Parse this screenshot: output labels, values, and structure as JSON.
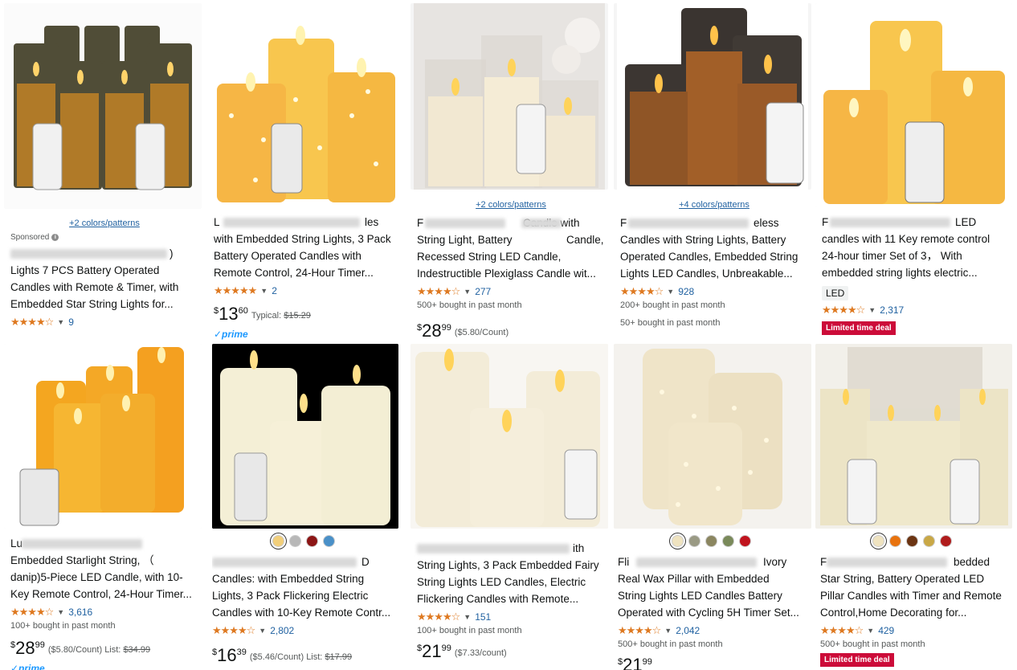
{
  "products": [
    {
      "colors_link": "+2 colors/patterns",
      "sponsored": "Sponsored",
      "title_lines": [
        "",
        "Lights 7 PCS Battery Operated",
        "Candles with Remote & Timer, with",
        "Embedded Star String Lights for..."
      ],
      "title_visible_end": ")",
      "stars": "★★★★☆",
      "rating_count": "9"
    },
    {
      "title_lines": [
        "L",
        "with Embedded String Lights, 3 Pack",
        "Battery Operated Candles with",
        "Remote Control, 24-Hour Timer..."
      ],
      "title_visible_end": "les",
      "stars": "★★★★★",
      "rating_count": "2",
      "price": {
        "currency": "$",
        "whole": "13",
        "fraction": "60",
        "typical_label": "Typical:",
        "typical": "$15.29"
      },
      "prime": "✓prime"
    },
    {
      "colors_link": "+2 colors/patterns",
      "title_lines": [
        "F",
        "String Light, Battery",
        "Recessed String LED Candle,",
        "Indestructible Plexiglass Candle wit..."
      ],
      "title_visible_end": "Candle with",
      "title_visible_end2": "Candle,",
      "stars": "★★★★☆",
      "rating_count": "277",
      "bought": "500+ bought in past month",
      "price": {
        "currency": "$",
        "whole": "28",
        "fraction": "99",
        "unit": "($5.80/Count)"
      }
    },
    {
      "colors_link": "+4 colors/patterns",
      "title_lines": [
        "F",
        "Candles with String Lights, Battery",
        "Operated Candles, Embedded String",
        "Lights LED Candles, Unbreakable..."
      ],
      "title_visible_end": "eless",
      "stars": "★★★★☆",
      "rating_count": "928",
      "bought": "200+ bought in past month",
      "bought2": "50+ bought in past month"
    },
    {
      "title_lines": [
        "F",
        "candles with 11 Key remote control",
        "24-hour timer Set of 3，  With",
        "embedded string lights electric..."
      ],
      "title_visible_end": "LED",
      "badge": "LED",
      "stars": "★★★★☆",
      "rating_count": "2,317",
      "deal": "Limited time deal"
    },
    {
      "title_lines": [
        "Lu",
        "Embedded Starlight String, （",
        "danip)5-Piece LED Candle, with 10-",
        "Key Remote Control, 24-Hour Timer..."
      ],
      "stars": "★★★★☆",
      "rating_count": "3,616",
      "bought": "100+ bought in past month",
      "price": {
        "currency": "$",
        "whole": "28",
        "fraction": "99",
        "unit": "($5.80/Count)",
        "list_label": "List:",
        "list": "$34.99"
      },
      "prime": "✓prime"
    },
    {
      "swatches": [
        "#f2cf7a",
        "#b8b8b8",
        "#8c1515",
        "#4a90c8"
      ],
      "title_lines": [
        "",
        "Candles: with Embedded String",
        "Lights, 3 Pack Flickering Electric",
        "Candles with 10-Key Remote Contr..."
      ],
      "title_visible_end": "D",
      "stars": "★★★★☆",
      "rating_count": "2,802",
      "price": {
        "currency": "$",
        "whole": "16",
        "fraction": "39",
        "unit": "($5.46/Count)",
        "list_label": "List:",
        "list": "$17.99"
      }
    },
    {
      "title_lines": [
        "",
        "String Lights, 3 Pack Embedded Fairy",
        "String Lights LED Candles, Electric",
        "Flickering Candles with Remote..."
      ],
      "title_visible_end": "ith",
      "stars": "★★★★☆",
      "rating_count": "151",
      "bought": "100+ bought in past month",
      "price": {
        "currency": "$",
        "whole": "21",
        "fraction": "99",
        "unit": "($7.33/count)"
      }
    },
    {
      "swatches": [
        "#efe3c0",
        "#9a9a84",
        "#8b8660",
        "#7a8a5a",
        "#c0141e"
      ],
      "title_lines": [
        "Fli",
        "Real Wax Pillar with Embedded",
        "String Lights LED Candles Battery",
        "Operated with Cycling 5H Timer Set..."
      ],
      "title_visible_end": "Ivory",
      "stars": "★★★★☆",
      "rating_count": "2,042",
      "bought": "500+ bought in past month",
      "price": {
        "currency": "$",
        "whole": "21",
        "fraction": "99"
      }
    },
    {
      "swatches": [
        "#efe3c0",
        "#e8730e",
        "#6b3412",
        "#c9a846",
        "#b01c1c"
      ],
      "title_lines": [
        "F",
        "Star String, Battery Operated LED",
        "Pillar Candles with Timer and Remote",
        "Control,Home Decorating for..."
      ],
      "title_visible_end": "bedded",
      "stars": "★★★★☆",
      "rating_count": "429",
      "bought": "500+ bought in past month",
      "deal": "Limited time deal"
    }
  ]
}
